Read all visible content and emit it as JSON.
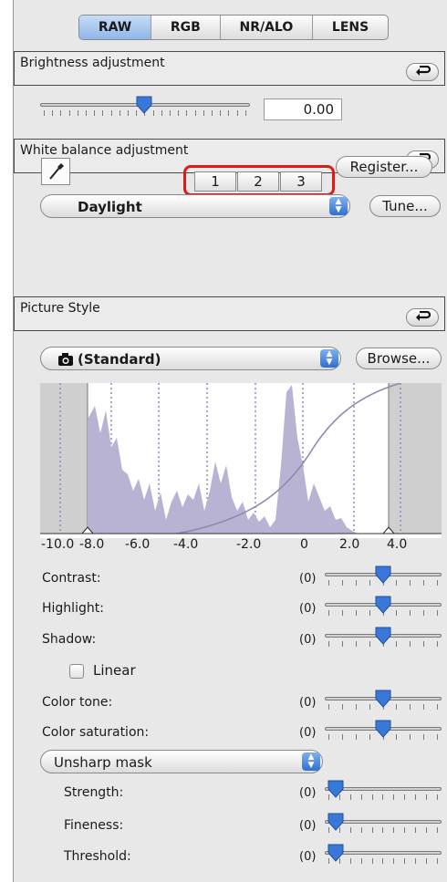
{
  "tabs": [
    "RAW",
    "RGB",
    "NR/ALO",
    "LENS"
  ],
  "active_tab": "RAW",
  "brightness": {
    "title": "Brightness adjustment",
    "value": "0.00",
    "slider_level": 0.5
  },
  "white_balance": {
    "title": "White balance adjustment",
    "buttons": [
      "1",
      "2",
      "3"
    ],
    "register_label": "Register...",
    "preset": "Daylight",
    "tune_label": "Tune..."
  },
  "picture_style": {
    "title": "Picture Style",
    "style": "(Standard)",
    "browse_label": "Browse...",
    "histogram_axis": [
      "-10.0",
      "-8.0",
      "-6.0",
      "-4.0",
      "-2.0",
      "0",
      "2.0",
      "4.0"
    ]
  },
  "adjustments": [
    {
      "label": "Contrast:",
      "value": "(0)",
      "level": 0.5
    },
    {
      "label": "Highlight:",
      "value": "(0)",
      "level": 0.5
    },
    {
      "label": "Shadow:",
      "value": "(0)",
      "level": 0.5
    }
  ],
  "linear_label": "Linear",
  "color": [
    {
      "label": "Color tone:",
      "value": "(0)",
      "level": 0.5
    },
    {
      "label": "Color saturation:",
      "value": "(0)",
      "level": 0.5
    }
  ],
  "sharpness": {
    "mode": "Unsharp mask",
    "rows": [
      {
        "label": "Strength:",
        "value": "(0)",
        "level": 0.0
      },
      {
        "label": "Fineness:",
        "value": "(0)",
        "level": 0.0
      },
      {
        "label": "Threshold:",
        "value": "(0)",
        "level": 0.0
      }
    ]
  },
  "colors": {
    "highlight_red": "#e01818",
    "active_tab": "#9fc2ef",
    "histogram_fill": "#b8b3d3",
    "knob_blue": "#3a78d8"
  }
}
